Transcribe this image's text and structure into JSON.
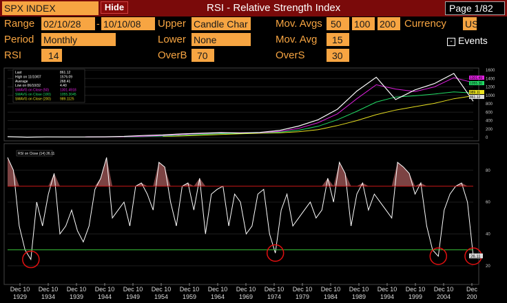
{
  "header": {
    "security": "SPX INDEX",
    "hide_label": "Hide",
    "title": "RSI - Relative Strength Index",
    "page": "Page 1/82"
  },
  "controls": {
    "range_label": "Range",
    "range_start": "02/10/28",
    "range_dash": "-",
    "range_end": "10/10/08",
    "upper_label": "Upper",
    "upper_value": "Candle Char",
    "mov_avgs_label": "Mov. Avgs",
    "mov_avg_1": "50",
    "mov_avg_2": "100",
    "mov_avg_3": "200",
    "currency_label": "Currency",
    "currency_value": "US",
    "period_label": "Period",
    "period_value": "Monthly",
    "lower_label": "Lower",
    "lower_value": "None",
    "mov_avg_label": "Mov. Avg",
    "mov_avg_value": "15",
    "events_label": "Events",
    "events_box": "-",
    "rsi_label": "RSI",
    "rsi_value": "14",
    "overb_label": "OverB",
    "overb_value": "70",
    "overs_label": "OverS",
    "overs_value": "30"
  },
  "colors": {
    "accent": "#f7a542",
    "bar": "#7a0a0a",
    "overbought_line": "#d01818",
    "oversold_line": "#39c239",
    "sma50": "#e020e0",
    "sma100": "#22dd66",
    "sma200": "#e8e020",
    "price": "#ffffff",
    "highlight_circle": "#e01010"
  },
  "chart_data": [
    {
      "type": "line",
      "panel": "upper",
      "title": "",
      "legend": [
        {
          "name": "Last",
          "value": "861.12"
        },
        {
          "name": "High on 11/10/07",
          "value": "1576.09"
        },
        {
          "name": "Average",
          "value": "268.41"
        },
        {
          "name": "Low on 06/10/32",
          "value": "4.40"
        },
        {
          "name": "SMAVG on Close (50)",
          "value": "1301.4918"
        },
        {
          "name": "SMAVG on Close (100)",
          "value": "1055.3045"
        },
        {
          "name": "SMAVG on Close (200)",
          "value": "989.1125"
        }
      ],
      "ylim": [
        0,
        1600
      ],
      "y_ticks": [
        "1600",
        "1400",
        "1200",
        "1000",
        "800",
        "600",
        "400",
        "200",
        "0"
      ],
      "right_labels": [
        "1301.49",
        "1055.30",
        "989.11",
        "861.12"
      ],
      "x": [
        "1928",
        "1932",
        "1936",
        "1940",
        "1944",
        "1948",
        "1952",
        "1956",
        "1960",
        "1964",
        "1968",
        "1972",
        "1976",
        "1980",
        "1984",
        "1988",
        "1992",
        "1996",
        "1998",
        "2000",
        "2002",
        "2004",
        "2006",
        "2007",
        "2008"
      ],
      "series": [
        {
          "name": "SPX INDEX",
          "values": [
            20,
            6,
            13,
            11,
            12,
            15,
            25,
            45,
            58,
            85,
            100,
            115,
            105,
            120,
            165,
            270,
            420,
            670,
            1100,
            1430,
            900,
            1130,
            1280,
            1520,
            861
          ]
        },
        {
          "name": "SMAVG on Close (50)",
          "values": [
            null,
            null,
            null,
            null,
            12,
            13,
            18,
            30,
            47,
            70,
            92,
            106,
            110,
            113,
            140,
            215,
            350,
            560,
            920,
            1250,
            1150,
            1090,
            1200,
            1420,
            1301
          ]
        },
        {
          "name": "SMAVG on Close (100)",
          "values": [
            null,
            null,
            null,
            null,
            null,
            null,
            15,
            20,
            32,
            52,
            72,
            90,
            100,
            108,
            122,
            170,
            265,
            420,
            620,
            840,
            960,
            990,
            1030,
            1080,
            1055
          ]
        },
        {
          "name": "SMAVG on Close (200)",
          "values": [
            null,
            null,
            null,
            null,
            null,
            null,
            null,
            null,
            25,
            35,
            50,
            70,
            85,
            98,
            108,
            135,
            185,
            280,
            400,
            540,
            650,
            730,
            810,
            920,
            989
          ]
        }
      ]
    },
    {
      "type": "line",
      "panel": "lower",
      "title": "",
      "legend": [
        {
          "name": "RSI on Close (14)",
          "value": "26.11"
        }
      ],
      "ylim": [
        10,
        95
      ],
      "y_ticks": [
        "80",
        "60",
        "40",
        "20"
      ],
      "right_label": "26.11",
      "overbought": 70,
      "oversold": 30,
      "x_tick_labels": [
        {
          "month": "Dec 10",
          "year": "1929"
        },
        {
          "month": "Dec 10",
          "year": "1934"
        },
        {
          "month": "Dec 10",
          "year": "1939"
        },
        {
          "month": "Dec 10",
          "year": "1944"
        },
        {
          "month": "Dec 10",
          "year": "1949"
        },
        {
          "month": "Dec 10",
          "year": "1954"
        },
        {
          "month": "Dec 10",
          "year": "1959"
        },
        {
          "month": "Dec 10",
          "year": "1964"
        },
        {
          "month": "Dec 10",
          "year": "1969"
        },
        {
          "month": "Dec 10",
          "year": "1974"
        },
        {
          "month": "Dec 10",
          "year": "1979"
        },
        {
          "month": "Dec 10",
          "year": "1984"
        },
        {
          "month": "Dec 10",
          "year": "1989"
        },
        {
          "month": "Dec 10",
          "year": "1994"
        },
        {
          "month": "Dec 10",
          "year": "1999"
        },
        {
          "month": "Dec 10",
          "year": "2004"
        },
        {
          "month": "Dec",
          "year": "200"
        }
      ],
      "x": [
        "1928",
        "1929",
        "1930",
        "1931",
        "1932",
        "1933",
        "1934",
        "1935",
        "1936",
        "1937",
        "1938",
        "1939",
        "1940",
        "1941",
        "1942",
        "1943",
        "1944",
        "1945",
        "1946",
        "1947",
        "1948",
        "1949",
        "1950",
        "1951",
        "1952",
        "1953",
        "1954",
        "1955",
        "1956",
        "1957",
        "1958",
        "1959",
        "1960",
        "1961",
        "1962",
        "1963",
        "1964",
        "1965",
        "1966",
        "1967",
        "1968",
        "1969",
        "1970",
        "1971",
        "1972",
        "1973",
        "1974",
        "1975",
        "1976",
        "1977",
        "1978",
        "1979",
        "1980",
        "1981",
        "1982",
        "1983",
        "1984",
        "1985",
        "1986",
        "1987",
        "1988",
        "1989",
        "1990",
        "1991",
        "1992",
        "1993",
        "1994",
        "1995",
        "1996",
        "1997",
        "1998",
        "1999",
        "2000",
        "2001",
        "2002",
        "2003",
        "2004",
        "2005",
        "2006",
        "2007",
        "2008"
      ],
      "series": [
        {
          "name": "RSI on Close (14)",
          "values": [
            88,
            80,
            45,
            30,
            24,
            60,
            45,
            65,
            78,
            40,
            45,
            55,
            42,
            35,
            45,
            68,
            75,
            88,
            50,
            55,
            60,
            45,
            70,
            72,
            65,
            55,
            85,
            82,
            60,
            45,
            70,
            72,
            55,
            75,
            40,
            65,
            68,
            70,
            45,
            65,
            60,
            40,
            45,
            65,
            68,
            40,
            28,
            55,
            65,
            45,
            50,
            55,
            60,
            50,
            55,
            75,
            60,
            85,
            78,
            45,
            65,
            72,
            55,
            65,
            60,
            55,
            50,
            85,
            82,
            78,
            65,
            72,
            45,
            30,
            26,
            55,
            65,
            70,
            72,
            60,
            26
          ]
        }
      ],
      "highlighted_lows": [
        "1932",
        "1974",
        "2002",
        "2008"
      ]
    }
  ]
}
